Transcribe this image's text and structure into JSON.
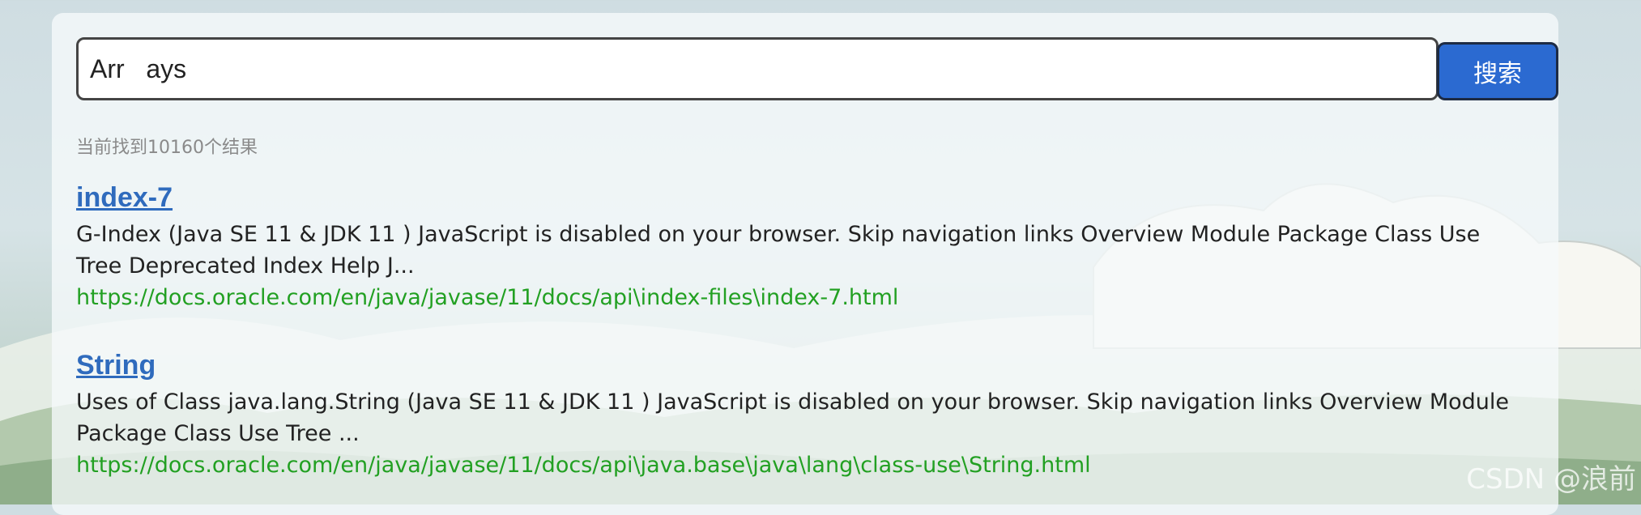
{
  "search": {
    "query": "Arr   ays",
    "button_label": "搜索"
  },
  "result_count_text": "当前找到10160个结果",
  "results": [
    {
      "title": "index-7",
      "snippet": "G-Index (Java SE 11 & JDK 11 ) JavaScript is disabled on your browser. Skip navigation links Overview Module Package Class Use Tree Deprecated Index Help J...",
      "url": "https://docs.oracle.com/en/java/javase/11/docs/api\\index-files\\index-7.html"
    },
    {
      "title": "String",
      "snippet": "Uses of Class java.lang.String (Java SE 11 & JDK 11 ) JavaScript is disabled on your browser. Skip navigation links Overview Module Package Class Use Tree ...",
      "url": "https://docs.oracle.com/en/java/javase/11/docs/api\\java.base\\java\\lang\\class-use\\String.html"
    }
  ],
  "watermark": "CSDN @浪前",
  "colors": {
    "link_title": "#2f6bbd",
    "link_url": "#22a022",
    "button_bg": "#2b6ad1",
    "muted_text": "#8a8a8a"
  }
}
